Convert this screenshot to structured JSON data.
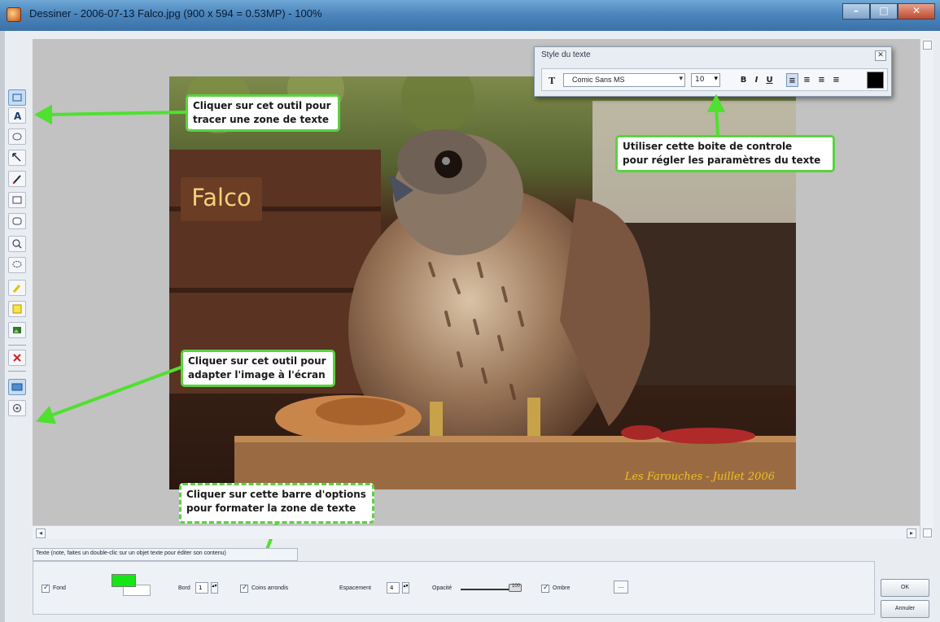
{
  "window": {
    "title": "Dessiner - 2006-07-13 Falco.jpg (900 x 594 = 0.53MP) - 100%",
    "controls": [
      "minimize",
      "maximize",
      "close"
    ]
  },
  "toolbar": {
    "tools": [
      {
        "name": "select-icon",
        "active": true
      },
      {
        "name": "text-icon",
        "active": false
      },
      {
        "name": "ellipse-icon",
        "active": false
      },
      {
        "name": "arrow-icon",
        "active": false
      },
      {
        "name": "pen-icon",
        "active": false
      },
      {
        "name": "rectangle-icon",
        "active": false
      },
      {
        "name": "rounded-rectangle-icon",
        "active": false
      },
      {
        "name": "zoom-icon",
        "active": false
      },
      {
        "name": "lasso-icon",
        "active": false
      },
      {
        "name": "highlighter-icon",
        "active": false
      },
      {
        "name": "sticky-note-icon",
        "active": false
      },
      {
        "name": "image-icon",
        "active": false
      },
      {
        "name": "delete-icon",
        "active": false
      },
      {
        "name": "fit-to-screen-icon",
        "active": true
      },
      {
        "name": "actual-size-icon",
        "active": false
      }
    ]
  },
  "photo": {
    "text_box": "Falco",
    "caption": "Les Farouches - Juillet 2006"
  },
  "callouts": {
    "text_tool": [
      "Cliquer sur cet outil pour",
      "tracer une zone de texte"
    ],
    "fit_screen": [
      "Cliquer sur cet outil pour",
      "adapter l'image à l'écran"
    ],
    "options_bar": [
      "Cliquer sur cette barre d'options",
      "pour formater la zone de texte"
    ],
    "control_box": [
      "Utiliser cette boite de controle",
      "pour régler les paramètres du texte"
    ]
  },
  "style_palette": {
    "title": "Style du texte",
    "font": "Comic Sans MS",
    "size": "10",
    "buttons": [
      "B",
      "I",
      "U"
    ],
    "align_buttons": [
      "≡",
      "≡",
      "≡",
      "≡"
    ],
    "color": "#000000"
  },
  "status": {
    "text": "Texte (note, faites un double-clic sur un objet texte pour éditer son contenu)"
  },
  "options": {
    "fill_label": "Fond",
    "border_label": "Bord",
    "border_value": "1",
    "rounded_label": "Coins arrondis",
    "spacing_label": "Espacement",
    "spacing_value": "4",
    "opacity_label": "Opacité",
    "opacity_value": "100",
    "shadow_label": "Ombre",
    "more_label": "..."
  },
  "buttons": {
    "ok": "OK",
    "cancel": "Annuler"
  },
  "colors": {
    "callout_border": "#5ad242",
    "arrow": "#4fe030",
    "fill": "#16e616"
  }
}
